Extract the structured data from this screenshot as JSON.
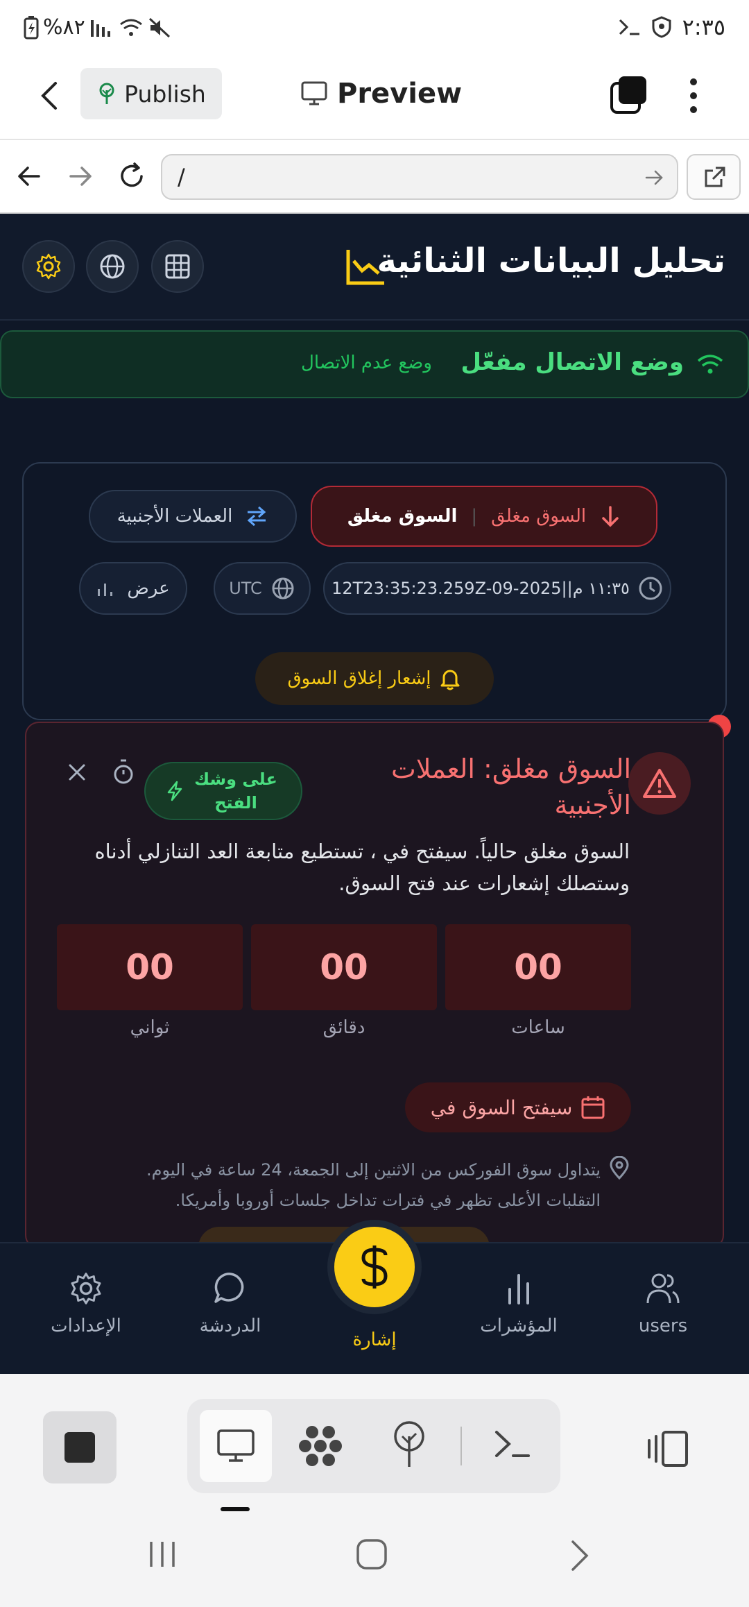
{
  "status_bar": {
    "time": "٢:٣٥",
    "battery": "%٨٢"
  },
  "app_bar": {
    "publish_label": "Publish",
    "preview_label": "Preview"
  },
  "browser": {
    "url": "/"
  },
  "header": {
    "title": "تحليل البيانات الثنائية"
  },
  "connection": {
    "status": "وضع الاتصال مفعّل",
    "mode_label": "وضع عدم الاتصال"
  },
  "market": {
    "status_label": "السوق مغلق",
    "status_label_bold": "السوق مغلق",
    "category_label": "العملات الأجنبية",
    "clock_text": "١١:٣٥ م||12T23:35:23.259Z-09-2025",
    "timezone": "UTC",
    "view_label": "عرض",
    "notify_label": "إشعار إغلاق السوق"
  },
  "alert": {
    "title": "السوق مغلق: العملات الأجنبية",
    "badge": "على وشك الفتح",
    "message": "السوق مغلق حالياً. سيفتح في ، تستطيع متابعة العد التنازلي أدناه وستصلك إشعارات عند فتح السوق.",
    "countdown": [
      {
        "value": "00",
        "label": "ساعات"
      },
      {
        "value": "00",
        "label": "دقائق"
      },
      {
        "value": "00",
        "label": "ثواني"
      }
    ],
    "opens_label": "سيفتح السوق في",
    "info_line1": "يتداول سوق الفوركس من الاثنين إلى الجمعة، 24 ساعة في اليوم.",
    "info_line2": "التقلبات الأعلى تظهر في فترات تداخل جلسات أوروبا وأمريكا."
  },
  "bottom_nav": {
    "users": "users",
    "indicators": "المؤشرات",
    "signal": "إشارة",
    "chat": "الدردشة",
    "settings": "الإعدادات"
  },
  "colors": {
    "accent": "#facc15",
    "success": "#22c55e",
    "danger": "#f87171",
    "background": "#0f1727"
  }
}
